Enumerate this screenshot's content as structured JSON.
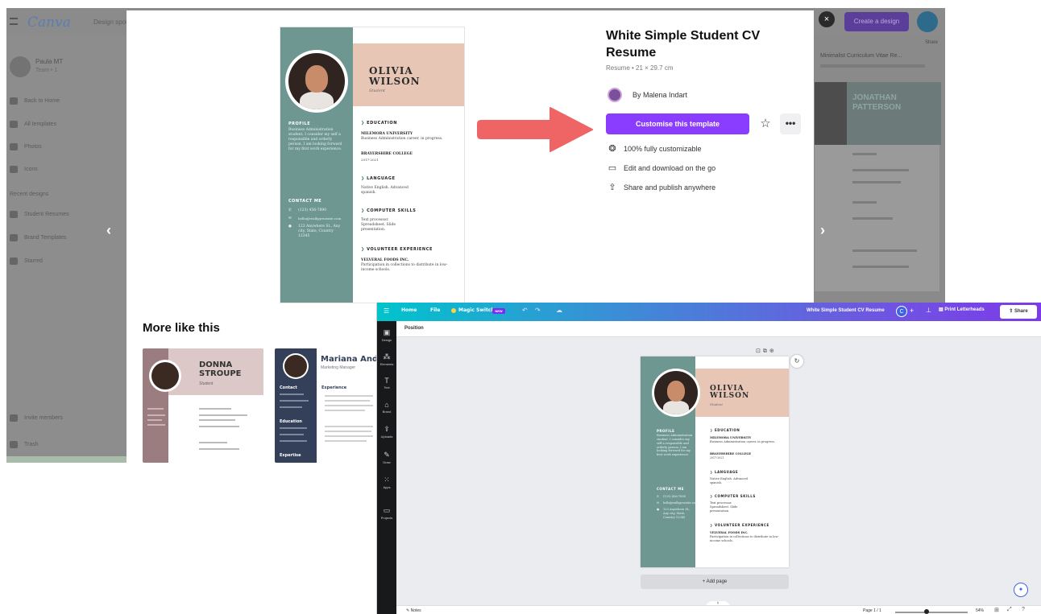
{
  "bg": {
    "logo": "Canva",
    "nav_design_spot": "Design spot",
    "team_name": "Paula MT",
    "team_sub": "Team • 1",
    "nav": [
      "Back to Home",
      "All templates",
      "Photos",
      "Icons",
      "Recent designs",
      "Student Resumes",
      "Brand Templates",
      "Starred",
      "Invite members",
      "Trash"
    ],
    "create_label": "Create a design",
    "right_card_caption": "Minimalist Curriculum Vitae Re...",
    "right_card_name": "JONATHAN PATTERSON",
    "share_label": "Share"
  },
  "modal": {
    "close_icon": "×",
    "title": "White Simple Student CV Resume",
    "meta": "Resume • 21 × 29.7 cm",
    "author": "By Malena Indart",
    "customise": "Customise this template",
    "star_icon": "☆",
    "more_icon": "•••",
    "features": [
      {
        "icon": "❂",
        "label": "100% fully customizable"
      },
      {
        "icon": "▭",
        "label": "Edit and download on the go"
      },
      {
        "icon": "⇪",
        "label": "Share and publish anywhere"
      }
    ],
    "more_like_this": "More like this",
    "prev_icon": "‹",
    "next_icon": "›"
  },
  "resume": {
    "first": "OLIVIA",
    "last": "WILSON",
    "role": "Student",
    "profile_head": "PROFILE",
    "profile_text": "Business Administration student. I consider my self a responsible and orderly person. I am looking forward for my first work experience.",
    "contact_head": "CONTACT ME",
    "phone": "(123) 456-7890",
    "email": "hello@reallygreatsite.com",
    "address": "123 Anywhere St., Any city, State, Country 12345",
    "education_head": "EDUCATION",
    "edu1_school": "MILEMORA UNIVERSITY",
    "edu1_text": "Business Administration career, in progress.",
    "edu2_school": "BRAYERSHIRE COLLEGE",
    "edu2_text": "2017-2021",
    "language_head": "LANGUAGE",
    "language_text": "Native English. Advanced spanish.",
    "skills_head": "COMPUTER SKILLS",
    "skills_text": "Text processor. Spreadsheet. Slide presentation.",
    "volunteer_head": "VOLUNTEER EXPERIENCE",
    "volunteer_org": "VELVERAL FOODS INC.",
    "volunteer_text": "Participation in collections to distribute in low-income schools."
  },
  "cards": {
    "card1_first": "DONNA",
    "card1_last": "STROUPE",
    "card1_role": "Student",
    "card2_name": "Mariana Anderson",
    "card2_role": "Marketing Manager",
    "card2_left_heads": [
      "Contact",
      "Education",
      "Expertise"
    ],
    "card2_right_head": "Experience"
  },
  "editor": {
    "menu": [
      "Home",
      "File",
      "Magic Switch"
    ],
    "new_badge": "NEW",
    "doc_title": "White Simple Student CV Resume",
    "user_initial": "C",
    "print_label": "Print Letterheads",
    "share_label": "Share",
    "side": [
      "Design",
      "Elements",
      "Text",
      "Brand",
      "Uploads",
      "Draw",
      "Apps",
      "Projects"
    ],
    "position_label": "Position",
    "add_page": "+ Add page",
    "notes": "Notes",
    "page_count": "Page 1 / 1",
    "zoom": "54%",
    "zoom_level": 0.43
  }
}
